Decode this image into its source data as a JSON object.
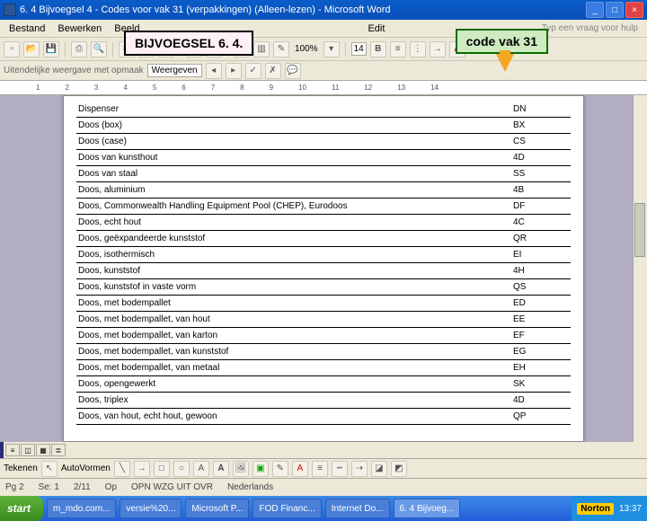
{
  "title": "6. 4 Bijvoegsel 4 - Codes voor vak 31 (verpakkingen) (Alleen-lezen) - Microsoft Word",
  "menu": {
    "m0": "Bestand",
    "m1": "Bewerken",
    "m2": "Beeld",
    "m3": "Edit",
    "help": "Typ een vraag voor hulp"
  },
  "toolbar": {
    "zoom": "100%",
    "fontsize": "14",
    "toggletxt": "Weergeven"
  },
  "callout": {
    "left": "BIJVOEGSEL 6. 4.",
    "right": "code vak 31"
  },
  "ruler": {
    "r1": "1",
    "r2": "2",
    "r3": "3",
    "r4": "4",
    "r5": "5",
    "r6": "6",
    "r7": "7",
    "r8": "8",
    "r9": "9",
    "r10": "10",
    "r11": "11",
    "r12": "12",
    "r13": "13",
    "r14": "14"
  },
  "rows": [
    {
      "desc": "Dispenser",
      "code": "DN"
    },
    {
      "desc": "Doos (box)",
      "code": "BX"
    },
    {
      "desc": "Doos (case)",
      "code": "CS"
    },
    {
      "desc": "Doos van kunsthout",
      "code": "4D"
    },
    {
      "desc": "Doos van staal",
      "code": "SS"
    },
    {
      "desc": "Doos, aluminium",
      "code": "4B"
    },
    {
      "desc": "Doos, Commonwealth Handling Equipment Pool (CHEP), Eurodoos",
      "code": "DF"
    },
    {
      "desc": "Doos, echt hout",
      "code": "4C"
    },
    {
      "desc": "Doos, geëxpandeerde kunststof",
      "code": "QR"
    },
    {
      "desc": "Doos, isothermisch",
      "code": "EI"
    },
    {
      "desc": "Doos, kunststof",
      "code": "4H"
    },
    {
      "desc": "Doos, kunststof in vaste vorm",
      "code": "QS"
    },
    {
      "desc": "Doos, met bodempallet",
      "code": "ED"
    },
    {
      "desc": "Doos, met bodempallet, van hout",
      "code": "EE"
    },
    {
      "desc": "Doos, met bodempallet, van karton",
      "code": "EF"
    },
    {
      "desc": "Doos, met bodempallet, van kunststof",
      "code": "EG"
    },
    {
      "desc": "Doos, met bodempallet, van metaal",
      "code": "EH"
    },
    {
      "desc": "Doos, opengewerkt",
      "code": "SK"
    },
    {
      "desc": "Doos, triplex",
      "code": "4D"
    },
    {
      "desc": "Doos, van hout, echt hout, gewoon",
      "code": "QP"
    }
  ],
  "draw": {
    "label": "Tekenen",
    "auto": "AutoVormen"
  },
  "status": {
    "pg": "Pg 2",
    "sec": "Se: 1",
    "pages": "2/11",
    "op": "Op",
    "modes": "OPN WZG UIT OVR",
    "lang": "Nederlands"
  },
  "taskbar": {
    "start": "start",
    "t0": "m_mdo.com...",
    "t1": "versie%20...",
    "t2": "Microsoft P...",
    "t3": "FOD Financ...",
    "t4": "Internet Do...",
    "t5": "6. 4 Bijvoeg...",
    "norton": "Norton",
    "clock": "13:37"
  }
}
